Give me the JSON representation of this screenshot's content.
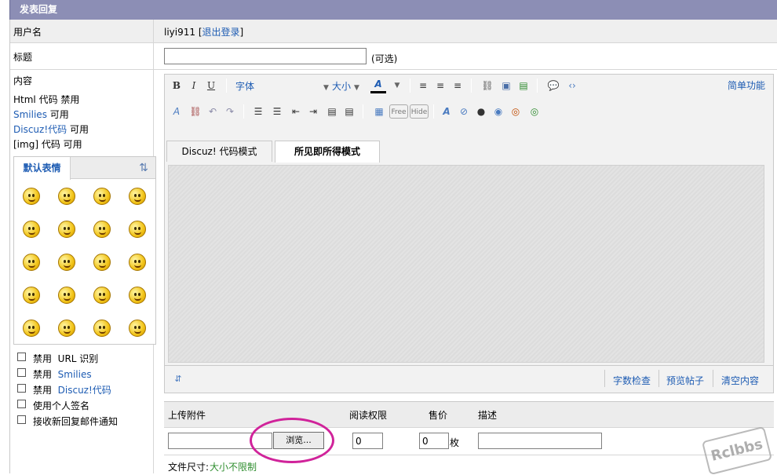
{
  "header": {
    "title": "发表回复"
  },
  "user_row": {
    "label": "用户名",
    "username": "liyi911",
    "bracket_open": "[",
    "logout": "退出登录",
    "bracket_close": "]"
  },
  "title_row": {
    "label": "标题",
    "value": "",
    "optional": "(可选)"
  },
  "content": {
    "label": "内容",
    "info": [
      {
        "prefix": "Html 代码",
        "link": "",
        "suffix": "禁用"
      },
      {
        "prefix": "",
        "link": "Smilies",
        "suffix": "可用"
      },
      {
        "prefix": "",
        "link": "Discuz!代码",
        "suffix": "可用"
      },
      {
        "prefix": "[img] 代码",
        "link": "",
        "suffix": "可用"
      }
    ]
  },
  "smilies": {
    "tab": "默认表情",
    "icons": [
      "smile-icon",
      "grin-icon",
      "green-man-icon",
      "victory-hand-icon",
      "clock-icon",
      "lips-icon",
      "handshake-icon",
      "phone-icon",
      "blush-icon",
      "angry-icon",
      "wink-icon",
      "sad-icon",
      "laugh-icon",
      "cry-icon",
      "mad-icon",
      "shocked-icon",
      "happy-icon",
      "kiss-icon",
      "shy-icon",
      "devil-icon"
    ]
  },
  "options": [
    {
      "text": "禁用",
      "link": "URL 识别",
      "plain": true
    },
    {
      "text": "禁用",
      "link": "Smilies",
      "plain": false
    },
    {
      "text": "禁用",
      "link": "Discuz!代码",
      "plain": false
    },
    {
      "text": "使用个人签名",
      "link": "",
      "plain": true
    },
    {
      "text": "接收新回复邮件通知",
      "link": "",
      "plain": true
    }
  ],
  "editor": {
    "bold": "B",
    "italic": "I",
    "underline": "U",
    "font": "字体",
    "size": "大小",
    "color": "A",
    "simple": "简单功能",
    "tab_code": "Discuz! 代码模式",
    "tab_wysiwyg": "所见即所得模式",
    "free": "Free",
    "hide": "Hide",
    "word_count": "字数检查",
    "preview": "预览帖子",
    "clear": "清空内容"
  },
  "attachment": {
    "col_upload": "上传附件",
    "col_perm": "阅读权限",
    "col_price": "售价",
    "col_desc": "描述",
    "browse": "浏览...",
    "perm_value": "0",
    "price_value": "0",
    "price_unit": "枚",
    "size_label": "文件尺寸:",
    "size_value": "大小不限制"
  },
  "watermark": "Rclbbs",
  "colors": {
    "header_bg": "#8c8eb5",
    "link": "#1e5cb3",
    "highlight_circle": "#d0239a",
    "green_text": "#2f8e2f"
  }
}
